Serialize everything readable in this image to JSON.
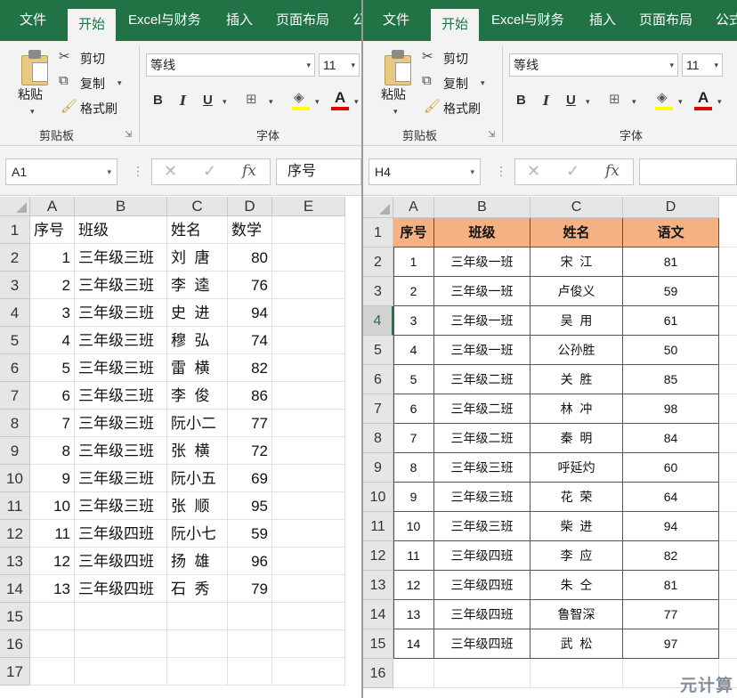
{
  "left": {
    "tabs": [
      "文件",
      "开始",
      "Excel与财务",
      "插入",
      "页面布局",
      "公"
    ],
    "active_tab": 1,
    "clipboard": {
      "paste": "粘贴",
      "cut": "剪切",
      "copy": "复制",
      "format_painter": "格式刷",
      "group_label": "剪贴板"
    },
    "font": {
      "name": "等线",
      "size": "11",
      "group_label": "字体",
      "bold": "B",
      "italic": "I",
      "underline": "U",
      "font_color_letter": "A"
    },
    "formula_bar": {
      "name_box": "A1",
      "fx": "fx",
      "formula": "序号"
    },
    "col_headers": [
      "A",
      "B",
      "C",
      "D",
      "E"
    ],
    "row_count": 17,
    "header_row": [
      "序号",
      "班级",
      "姓名",
      "数学"
    ],
    "rows": [
      [
        "1",
        "三年级三班",
        "刘  唐",
        "80"
      ],
      [
        "2",
        "三年级三班",
        "李  逵",
        "76"
      ],
      [
        "3",
        "三年级三班",
        "史  进",
        "94"
      ],
      [
        "4",
        "三年级三班",
        "穆  弘",
        "74"
      ],
      [
        "5",
        "三年级三班",
        "雷  横",
        "82"
      ],
      [
        "6",
        "三年级三班",
        "李  俊",
        "86"
      ],
      [
        "7",
        "三年级三班",
        "阮小二",
        "77"
      ],
      [
        "8",
        "三年级三班",
        "张  横",
        "72"
      ],
      [
        "9",
        "三年级三班",
        "阮小五",
        "69"
      ],
      [
        "10",
        "三年级三班",
        "张  顺",
        "95"
      ],
      [
        "11",
        "三年级四班",
        "阮小七",
        "59"
      ],
      [
        "12",
        "三年级四班",
        "扬  雄",
        "96"
      ],
      [
        "13",
        "三年级四班",
        "石  秀",
        "79"
      ]
    ]
  },
  "right": {
    "tabs": [
      "文件",
      "开始",
      "Excel与财务",
      "插入",
      "页面布局",
      "公式"
    ],
    "active_tab": 1,
    "clipboard": {
      "paste": "粘贴",
      "cut": "剪切",
      "copy": "复制",
      "format_painter": "格式刷",
      "group_label": "剪贴板"
    },
    "font": {
      "name": "等线",
      "size": "11",
      "group_label": "字体",
      "bold": "B",
      "italic": "I",
      "underline": "U",
      "font_color_letter": "A"
    },
    "formula_bar": {
      "name_box": "H4",
      "fx": "fx",
      "formula": ""
    },
    "col_headers": [
      "A",
      "B",
      "C",
      "D"
    ],
    "row_count": 16,
    "selected_row": 4,
    "header_row": [
      "序号",
      "班级",
      "姓名",
      "语文"
    ],
    "rows": [
      [
        "1",
        "三年级一班",
        "宋  江",
        "81"
      ],
      [
        "2",
        "三年级一班",
        "卢俊义",
        "59"
      ],
      [
        "3",
        "三年级一班",
        "吴  用",
        "61"
      ],
      [
        "4",
        "三年级一班",
        "公孙胜",
        "50"
      ],
      [
        "5",
        "三年级二班",
        "关  胜",
        "85"
      ],
      [
        "6",
        "三年级二班",
        "林  冲",
        "98"
      ],
      [
        "7",
        "三年级二班",
        "秦  明",
        "84"
      ],
      [
        "8",
        "三年级三班",
        "呼延灼",
        "60"
      ],
      [
        "9",
        "三年级三班",
        "花  荣",
        "64"
      ],
      [
        "10",
        "三年级三班",
        "柴  进",
        "94"
      ],
      [
        "11",
        "三年级四班",
        "李  应",
        "82"
      ],
      [
        "12",
        "三年级四班",
        "朱  仝",
        "81"
      ],
      [
        "13",
        "三年级四班",
        "鲁智深",
        "77"
      ],
      [
        "14",
        "三年级四班",
        "武  松",
        "97"
      ]
    ]
  },
  "watermark": "元计算",
  "colors": {
    "excel_green": "#217346",
    "header_fill": "#f4b183",
    "highlight_yellow": "#ffff00",
    "font_red": "#e00000"
  }
}
